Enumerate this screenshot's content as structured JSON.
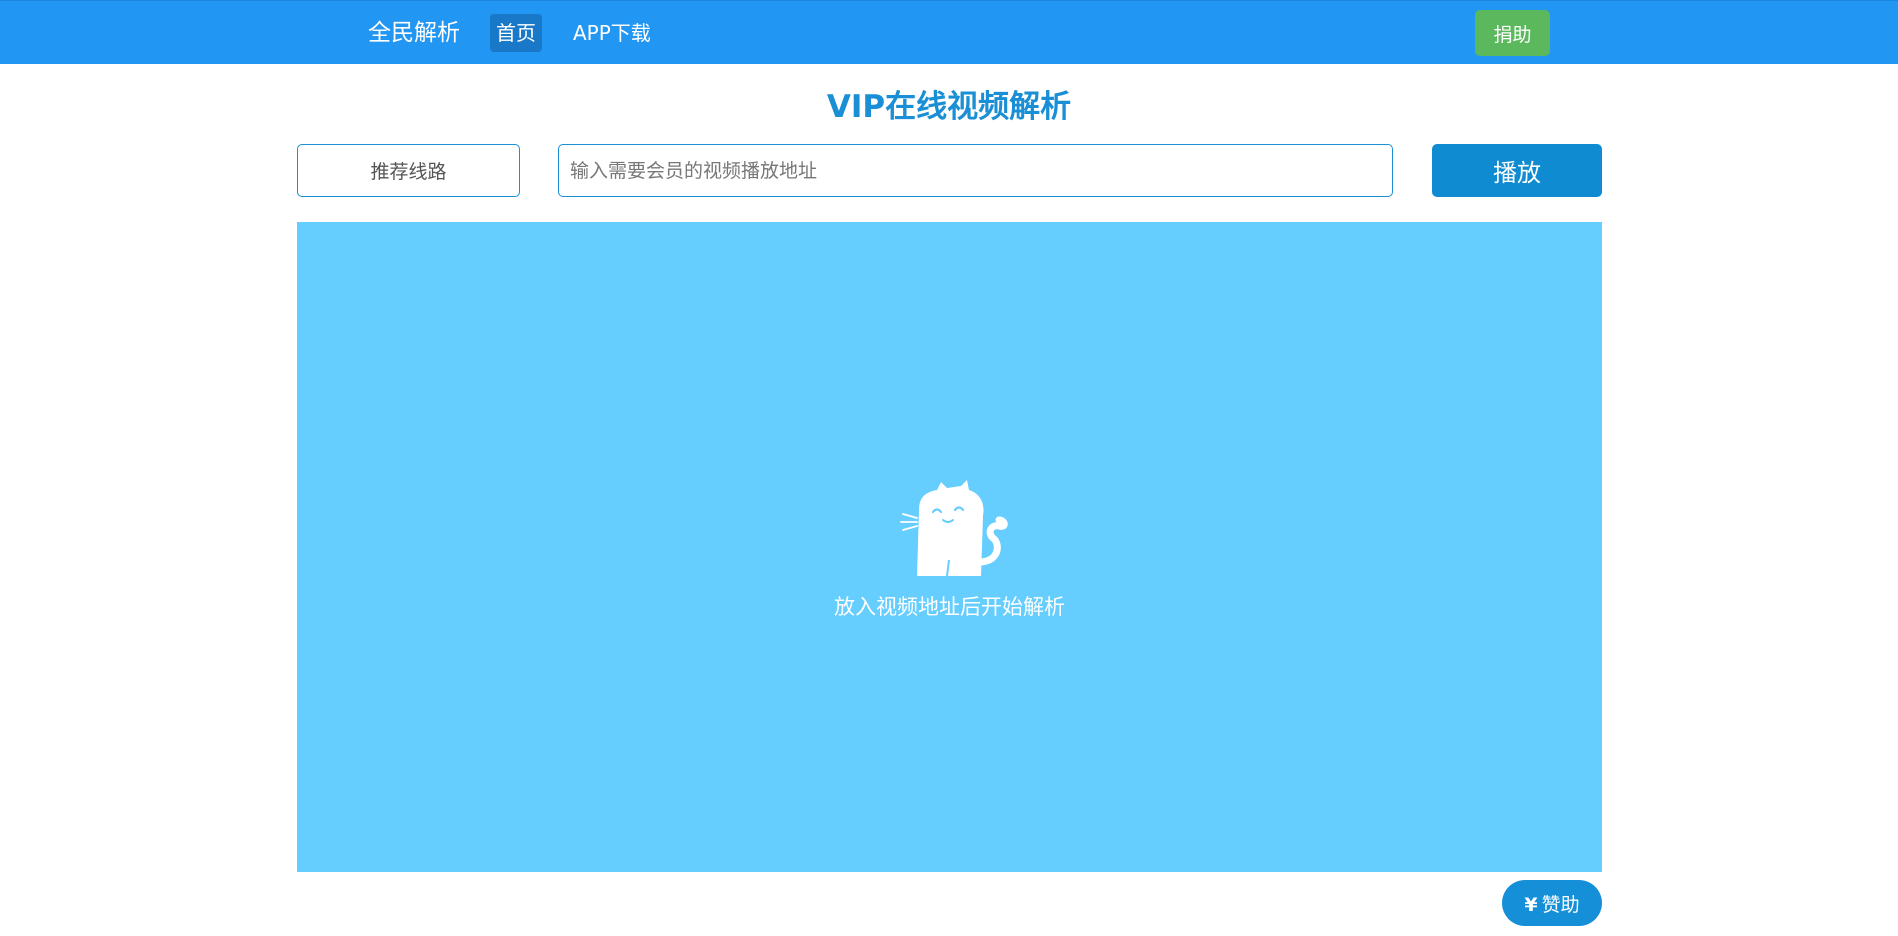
{
  "colors": {
    "navbar": "#2196f3",
    "nav_active": "#1a78c8",
    "donate_green": "#5cb85c",
    "accent_blue": "#1a8fd5",
    "play_button": "#0f8bd2",
    "player_bg": "#66cdff"
  },
  "navbar": {
    "brand": "全民解析",
    "items": [
      {
        "label": "首页",
        "active": true
      },
      {
        "label": "APP下载",
        "active": false
      }
    ],
    "donate_label": "捐助"
  },
  "main": {
    "title": "VIP在线视频解析",
    "route_label": "推荐线路",
    "url_placeholder": "输入需要会员的视频播放地址",
    "url_value": "",
    "play_label": "播放"
  },
  "player": {
    "icon": "cat-icon",
    "hint": "放入视频地址后开始解析"
  },
  "sponsor": {
    "symbol": "¥",
    "label": "赞助"
  }
}
